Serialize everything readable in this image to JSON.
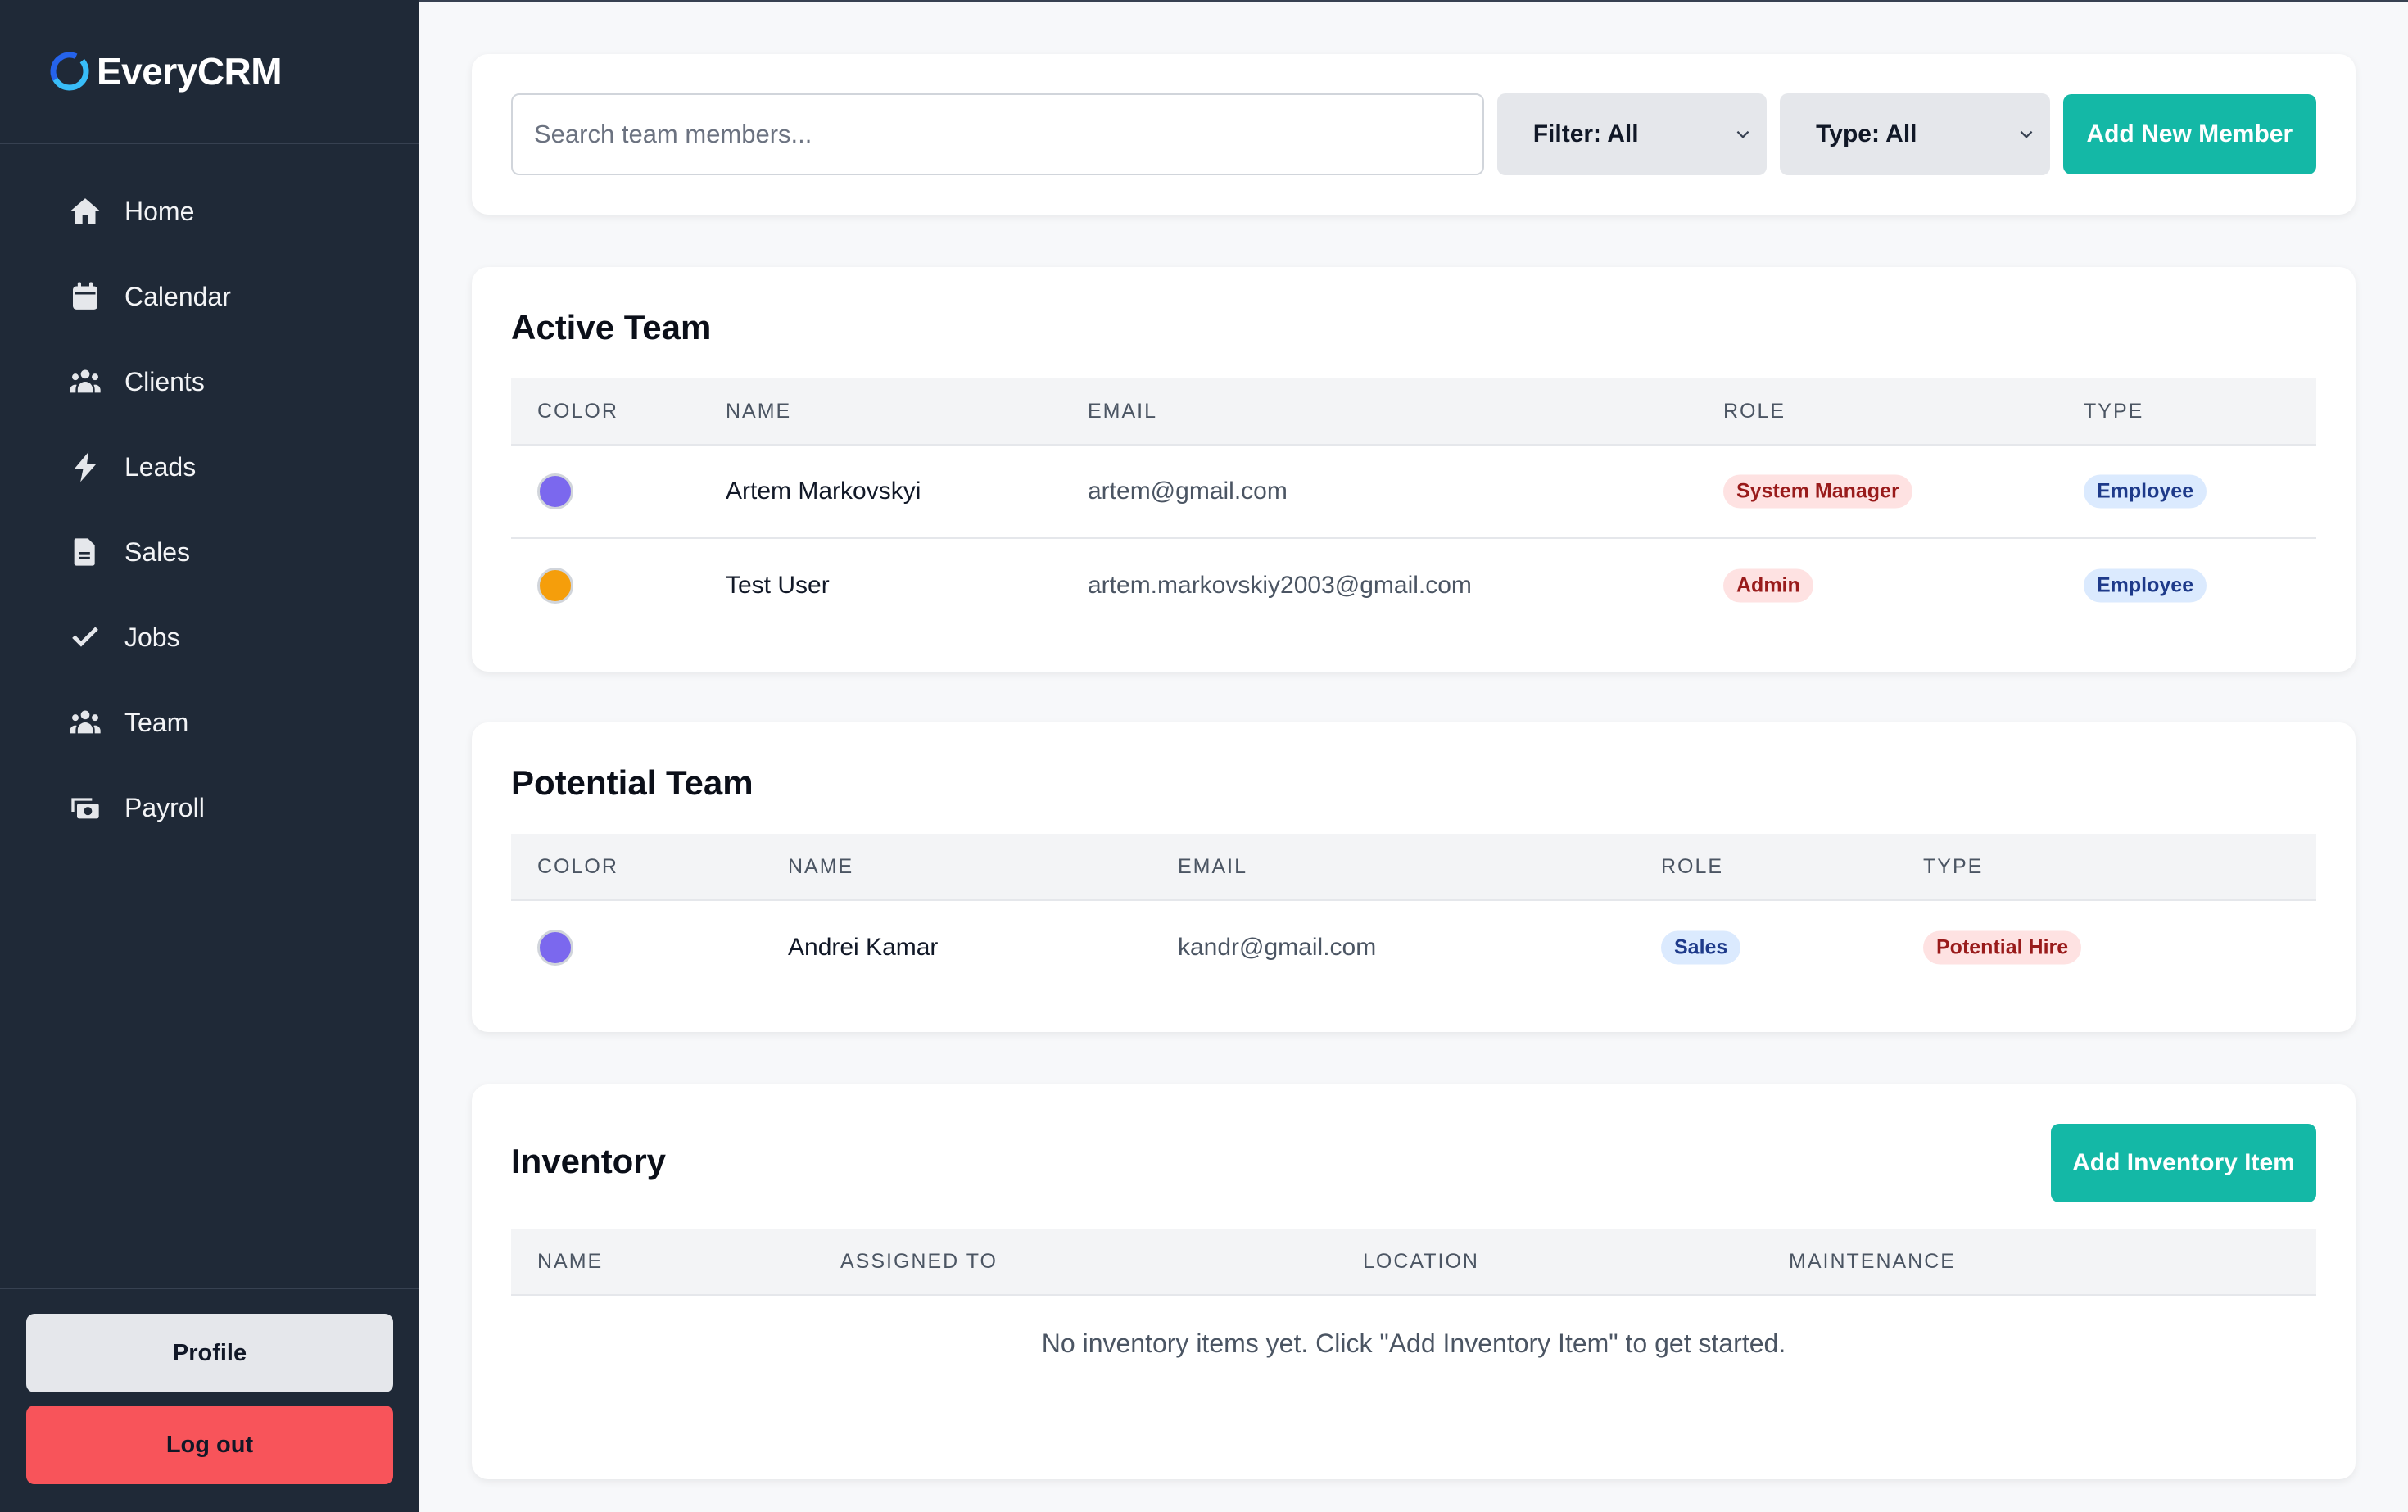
{
  "app": {
    "name": "EveryCRM"
  },
  "sidebar": {
    "items": [
      {
        "label": "Home",
        "icon": "home-icon"
      },
      {
        "label": "Calendar",
        "icon": "calendar-icon"
      },
      {
        "label": "Clients",
        "icon": "users-icon"
      },
      {
        "label": "Leads",
        "icon": "bolt-icon"
      },
      {
        "label": "Sales",
        "icon": "document-icon"
      },
      {
        "label": "Jobs",
        "icon": "check-icon"
      },
      {
        "label": "Team",
        "icon": "users-icon"
      },
      {
        "label": "Payroll",
        "icon": "money-icon"
      }
    ],
    "profile_label": "Profile",
    "logout_label": "Log out"
  },
  "toolbar": {
    "search_placeholder": "Search team members...",
    "filter_label": "Filter: All",
    "type_label": "Type: All",
    "add_member_label": "Add New Member"
  },
  "active_team": {
    "title": "Active Team",
    "columns": [
      "COLOR",
      "NAME",
      "EMAIL",
      "ROLE",
      "TYPE"
    ],
    "rows": [
      {
        "color": "#7b68ee",
        "name": "Artem Markovskyi",
        "email": "artem@gmail.com",
        "role": "System Manager",
        "type": "Employee"
      },
      {
        "color": "#f59e0b",
        "name": "Test User",
        "email": "artem.markovskiy2003@gmail.com",
        "role": "Admin",
        "type": "Employee"
      }
    ]
  },
  "potential_team": {
    "title": "Potential Team",
    "columns": [
      "COLOR",
      "NAME",
      "EMAIL",
      "ROLE",
      "TYPE"
    ],
    "rows": [
      {
        "color": "#7b68ee",
        "name": "Andrei Kamar",
        "email": "kandr@gmail.com",
        "role": "Sales",
        "type": "Potential Hire"
      }
    ]
  },
  "inventory": {
    "title": "Inventory",
    "add_label": "Add Inventory Item",
    "columns": [
      "NAME",
      "ASSIGNED TO",
      "LOCATION",
      "MAINTENANCE"
    ],
    "empty_message": "No inventory items yet. Click \"Add Inventory Item\" to get started."
  },
  "colors": {
    "sidebar_bg": "#1f2937",
    "accent": "#14b8a6",
    "logout": "#f8545a"
  }
}
